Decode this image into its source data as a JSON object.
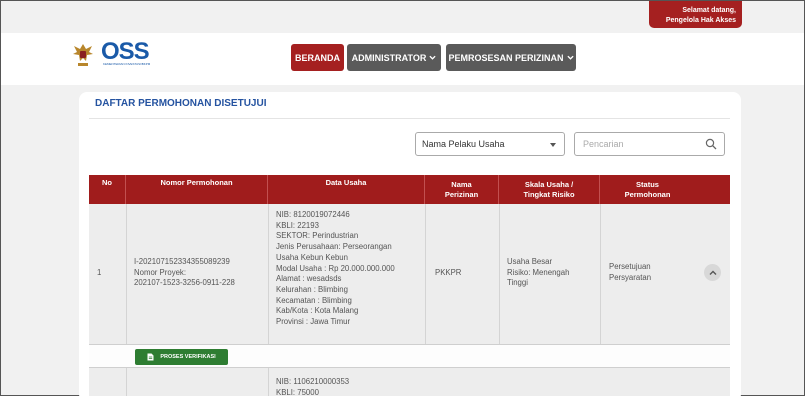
{
  "header": {
    "welcome_line1": "Selamat datang,",
    "welcome_line2": "Pengelola Hak Akses",
    "logo_text": "OSS",
    "logo_sub": "KEMENTERIAN INVESTASI/BKPM"
  },
  "nav": {
    "home": "BERANDA",
    "admin": "ADMINISTRATOR",
    "processing": "PEMROSESAN PERIZINAN"
  },
  "page": {
    "title": "DAFTAR PERMOHONAN DISETUJUI",
    "filter_selected": "Nama Pelaku Usaha",
    "search_placeholder": "Pencarian"
  },
  "table": {
    "headers": {
      "no": "No",
      "nomor": "Nomor Permohonan",
      "data_usaha": "Data Usaha",
      "nama_perizinan_1": "Nama",
      "nama_perizinan_2": "Perizinan",
      "skala_1": "Skala Usaha /",
      "skala_2": "Tingkat Risiko",
      "status_1": "Status",
      "status_2": "Permohonan"
    },
    "rows": [
      {
        "no": "1",
        "nomor_1": "I-202107152334355089239",
        "nomor_2": "Nomor Proyek:",
        "nomor_3": "202107-1523-3256-0911-228",
        "data_usaha": [
          "NIB: 8120019072446",
          "KBLI: 22193",
          "SEKTOR: Perindustrian",
          "Jenis Perusahaan: Perseorangan",
          "Usaha Kebun Kebun",
          "Modal Usaha : Rp 20.000.000.000",
          "Alamat : wesadsds",
          "Kelurahan : Blimbing",
          "Kecamatan : Blimbing",
          "Kab/Kota : Kota Malang",
          "Provinsi : Jawa Timur"
        ],
        "nama_perizinan": "PKKPR",
        "skala_1": "Usaha Besar",
        "skala_2": "Risiko: Menengah",
        "skala_3": "Tinggi",
        "status_1": "Persetujuan",
        "status_2": "Persyaratan",
        "action": "PROSES VERIFIKASI"
      },
      {
        "data_usaha": [
          "NIB: 1106210000353",
          "KBLI: 75000"
        ]
      }
    ]
  }
}
